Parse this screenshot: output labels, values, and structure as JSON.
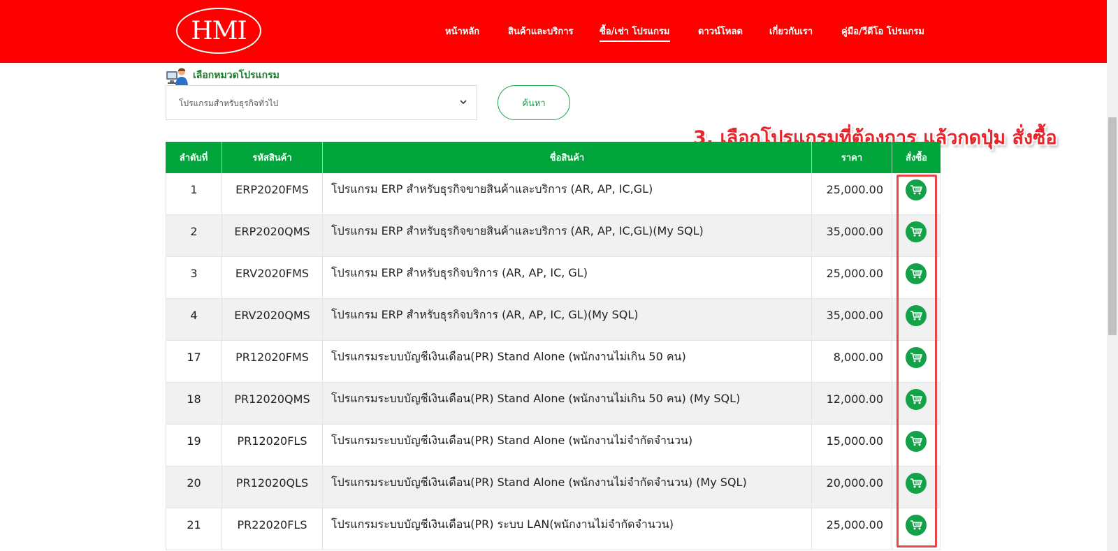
{
  "header": {
    "logo_text": "HMI",
    "nav": [
      {
        "label": "หน้าหลัก",
        "active": false
      },
      {
        "label": "สินค้าและบริการ",
        "active": false
      },
      {
        "label": "ซื้อ/เช่า โปรแกรม",
        "active": true
      },
      {
        "label": "ดาวน์โหลด",
        "active": false
      },
      {
        "label": "เกี่ยวกับเรา",
        "active": false
      },
      {
        "label": "คู่มือ/วีดีโอ โปรแกรม",
        "active": false
      }
    ],
    "colors": {
      "background": "#ff0000",
      "text": "#ffffff"
    }
  },
  "category": {
    "label": "เลือกหมวดโปรแกรม",
    "icon": "user-computer-icon",
    "selected": "โปรแกรมสำหรับธุรกิจทั่วไป",
    "search_label": "ค้นหา"
  },
  "annotation": "3. เลือกโปรแกรมที่ต้องการ แล้วกดปุ่ม สั่งซื้อ",
  "table": {
    "headers": {
      "no": "ลำดับที่",
      "code": "รหัสสินค้า",
      "name": "ชื่อสินค้า",
      "price": "ราคา",
      "order": "สั่งซื้อ"
    },
    "rows": [
      {
        "no": "1",
        "code": "ERP2020FMS",
        "name": "โปรแกรม ERP สำหรับธุรกิจขายสินค้าและบริการ (AR, AP, IC,GL)",
        "price": "25,000.00"
      },
      {
        "no": "2",
        "code": "ERP2020QMS",
        "name": "โปรแกรม ERP สำหรับธุรกิจขายสินค้าและบริการ (AR, AP, IC,GL)(My SQL)",
        "price": "35,000.00"
      },
      {
        "no": "3",
        "code": "ERV2020FMS",
        "name": "โปรแกรม ERP สำหรับธุรกิจบริการ (AR, AP, IC, GL)",
        "price": "25,000.00"
      },
      {
        "no": "4",
        "code": "ERV2020QMS",
        "name": "โปรแกรม ERP สำหรับธุรกิจบริการ (AR, AP, IC, GL)(My SQL)",
        "price": "35,000.00"
      },
      {
        "no": "17",
        "code": "PR12020FMS",
        "name": "โปรแกรมระบบบัญชีเงินเดือน(PR) Stand Alone (พนักงานไม่เกิน 50 คน)",
        "price": "8,000.00"
      },
      {
        "no": "18",
        "code": "PR12020QMS",
        "name": "โปรแกรมระบบบัญชีเงินเดือน(PR) Stand Alone (พนักงานไม่เกิน 50 คน) (My SQL)",
        "price": "12,000.00"
      },
      {
        "no": "19",
        "code": "PR12020FLS",
        "name": "โปรแกรมระบบบัญชีเงินเดือน(PR) Stand Alone (พนักงานไม่จำกัดจำนวน)",
        "price": "15,000.00"
      },
      {
        "no": "20",
        "code": "PR12020QLS",
        "name": "โปรแกรมระบบบัญชีเงินเดือน(PR) Stand Alone (พนักงานไม่จำกัดจำนวน) (My SQL)",
        "price": "20,000.00"
      },
      {
        "no": "21",
        "code": "PR22020FLS",
        "name": "โปรแกรมระบบบัญชีเงินเดือน(PR) ระบบ LAN(พนักงานไม่จำกัดจำนวน)",
        "price": "25,000.00"
      }
    ],
    "colors": {
      "header_bg": "#00a43a",
      "alt_row_bg": "#f1f1f1",
      "cart_bg": "#12a247",
      "highlight": "#e8474a"
    }
  }
}
